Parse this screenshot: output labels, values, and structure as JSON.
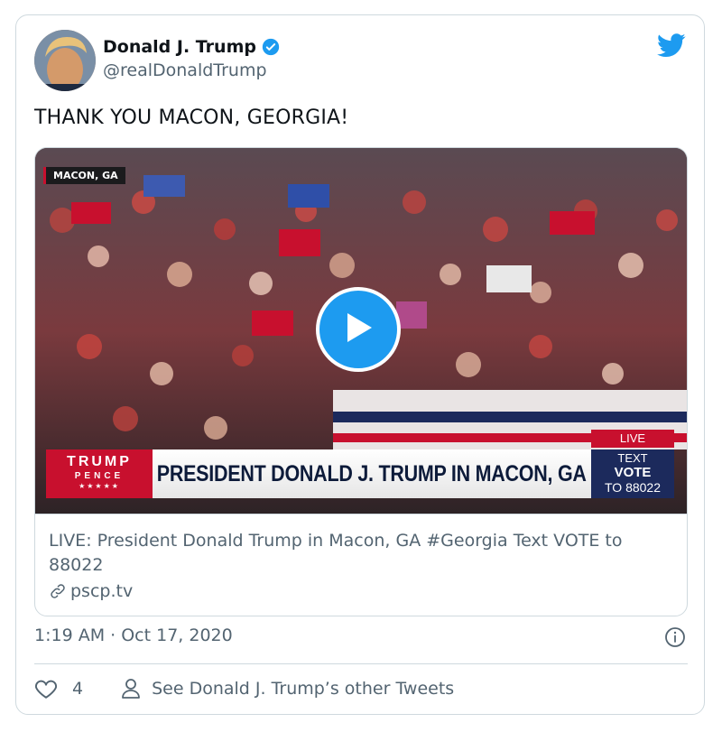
{
  "author": {
    "name": "Donald J. Trump",
    "handle": "@realDonaldTrump"
  },
  "tweet": {
    "text": "THANK YOU MACON, GEORGIA!",
    "timestamp": "1:19 AM · Oct 17, 2020"
  },
  "media": {
    "location_tag": "MACON, GA",
    "banner_text": "PRESIDENT DONALD J. TRUMP IN MACON, GA",
    "logo_top": "TRUMP",
    "logo_bottom": "PENCE",
    "logo_stars": "★★★★★",
    "live_label": "LIVE",
    "vote_line1": "TEXT",
    "vote_line2": "VOTE",
    "vote_line3": "TO 88022"
  },
  "link_card": {
    "title": "LIVE: President Donald Trump in Macon, GA #Georgia Text VOTE to 88022",
    "domain": "pscp.tv"
  },
  "actions": {
    "like_count": "4",
    "see_other": "See Donald J. Trump’s other Tweets"
  },
  "icons": [
    "verified-badge-icon",
    "twitter-bird-icon",
    "play-icon",
    "link-icon",
    "info-icon",
    "heart-icon",
    "person-icon"
  ],
  "colors": {
    "twitter_blue": "#1d9bf0",
    "text_primary": "#0f1419",
    "text_secondary": "#536471",
    "campaign_red": "#c8102e",
    "campaign_navy": "#1c2a5c"
  }
}
